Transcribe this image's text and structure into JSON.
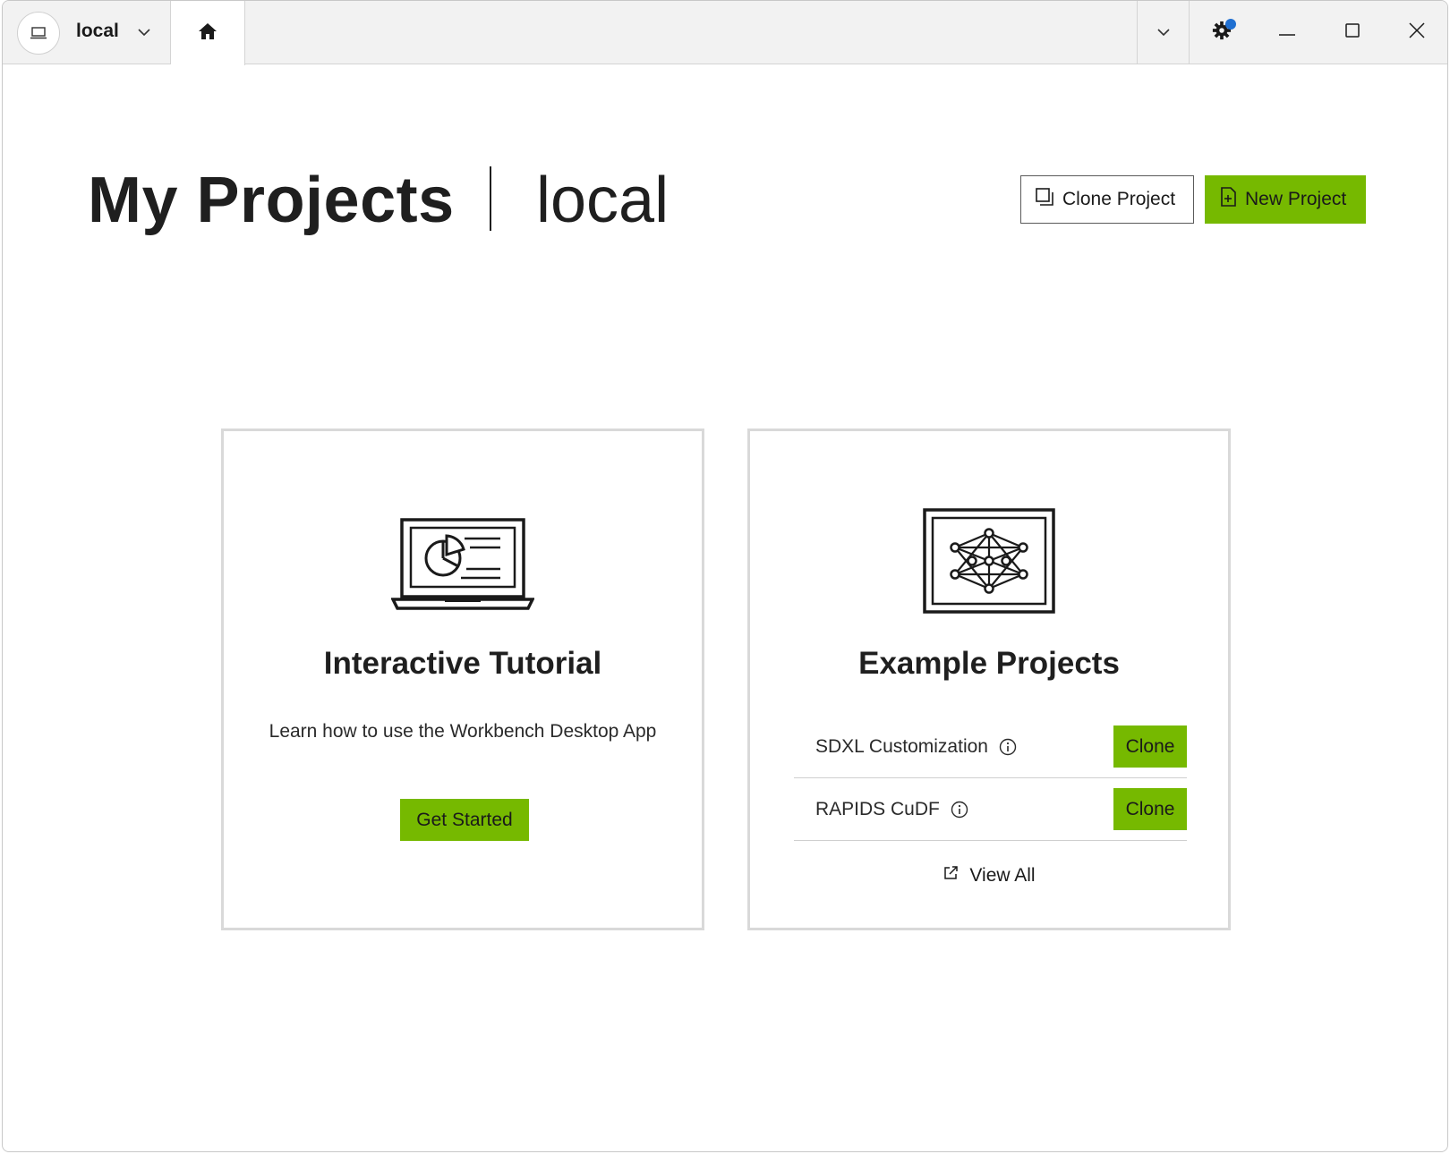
{
  "titlebar": {
    "context_label": "local",
    "icons": {
      "context": "laptop-icon",
      "context_dropdown": "chevron-down-icon",
      "home": "home-icon",
      "tabs_dropdown": "chevron-down-icon",
      "settings": "gear-icon",
      "minimize": "minimize-icon",
      "maximize": "maximize-icon",
      "close": "close-icon"
    },
    "notification_color": "#1f6fd1"
  },
  "header": {
    "title": "My Projects",
    "subtitle": "local",
    "clone_project_label": "Clone Project",
    "new_project_label": "New Project"
  },
  "tutorial_card": {
    "title": "Interactive Tutorial",
    "description": "Learn how to use the Workbench Desktop App",
    "button_label": "Get Started",
    "illustration": "laptop-chart-icon"
  },
  "examples_card": {
    "title": "Example Projects",
    "illustration": "neural-network-icon",
    "items": [
      {
        "name": "SDXL Customization",
        "button_label": "Clone"
      },
      {
        "name": "RAPIDS CuDF",
        "button_label": "Clone"
      }
    ],
    "view_all_label": "View All"
  },
  "colors": {
    "accent": "#76b900",
    "text": "#1f1f1f",
    "titlebar_bg": "#f2f2f2",
    "card_border": "#d9d9d9"
  }
}
